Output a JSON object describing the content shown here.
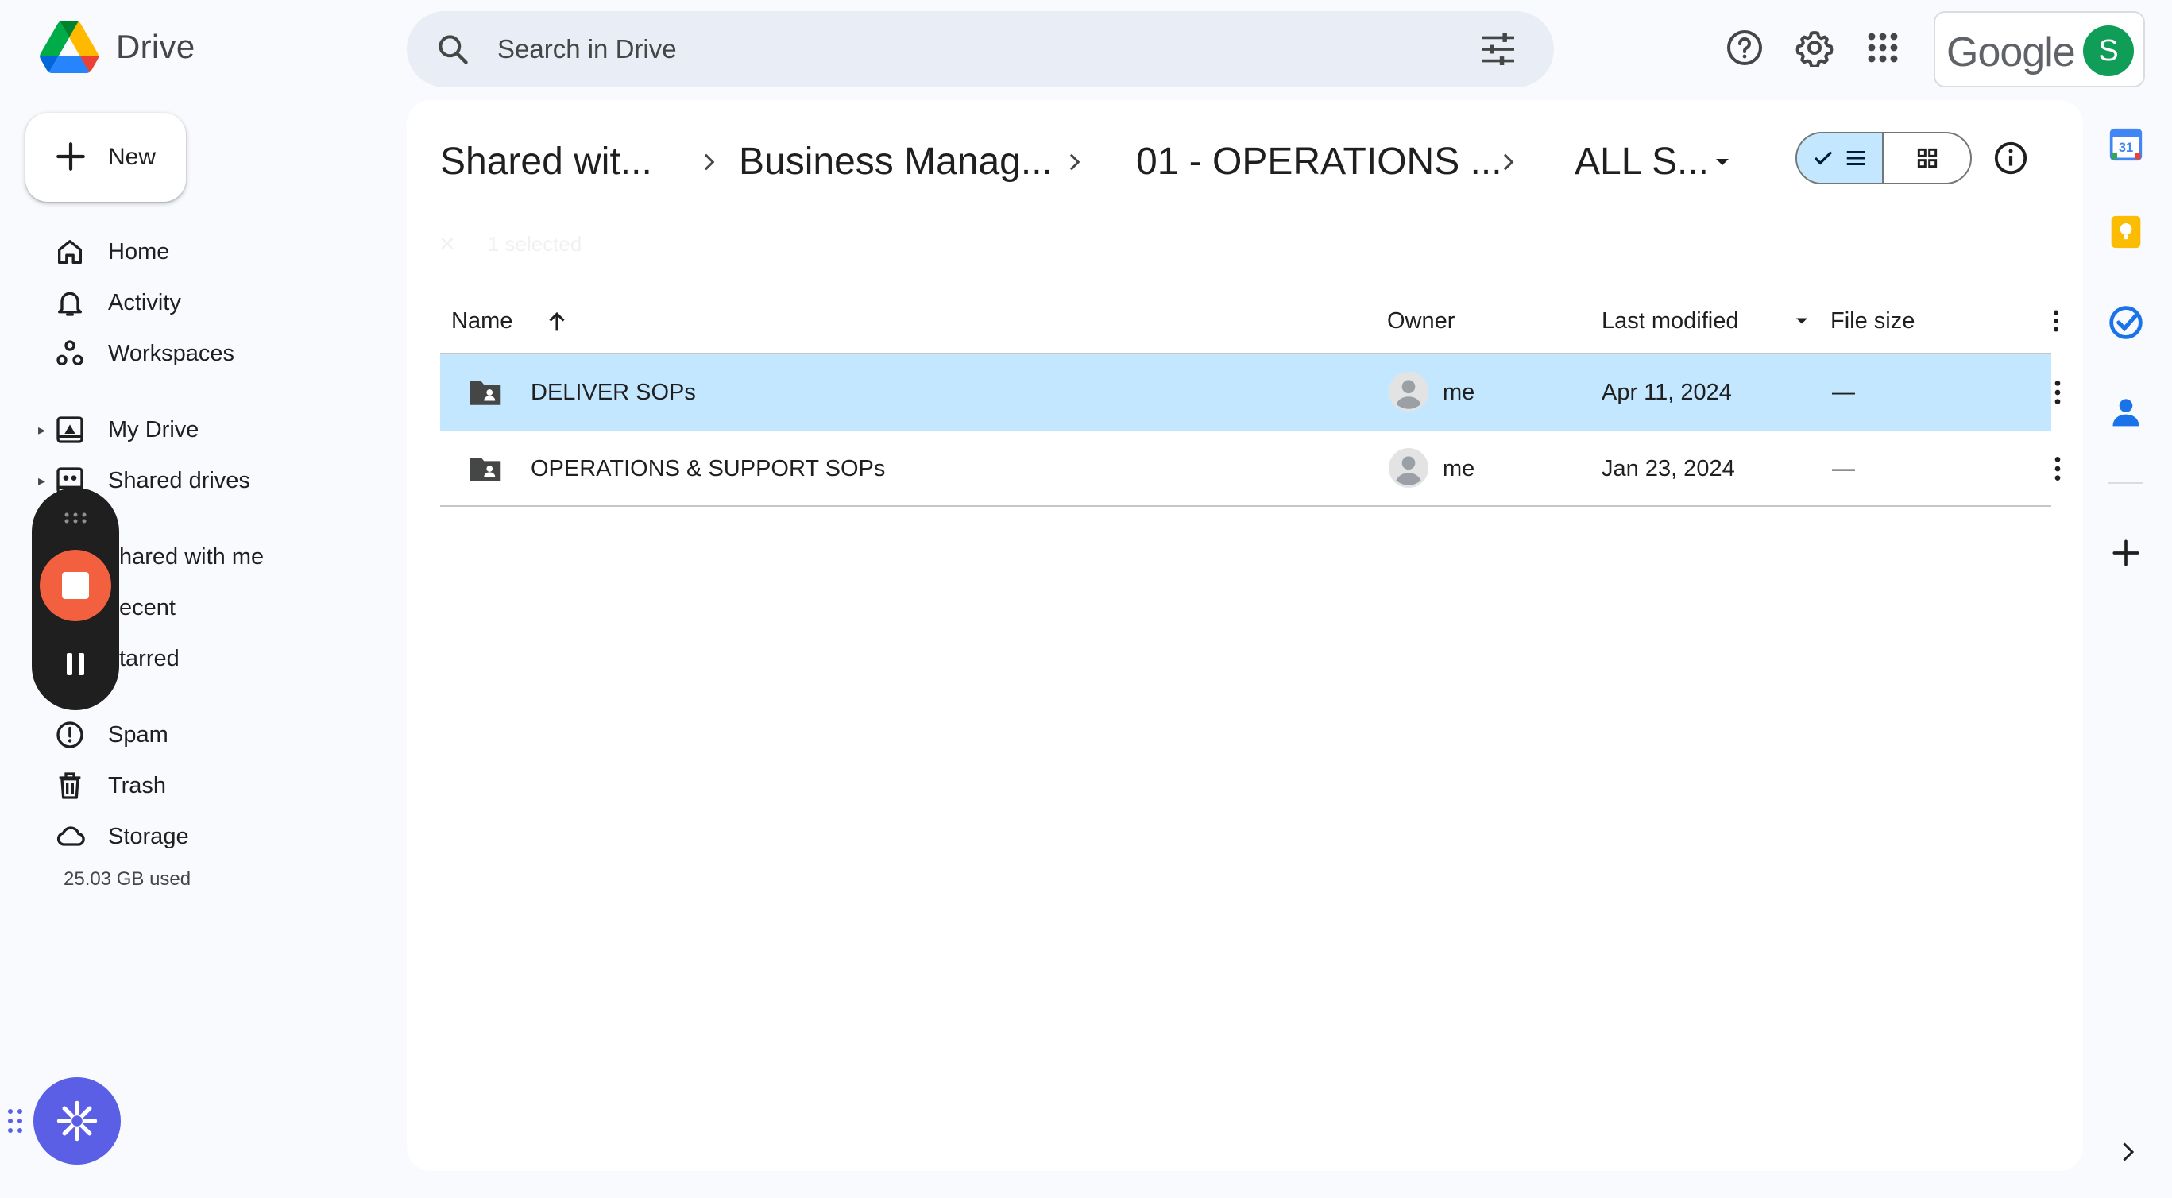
{
  "app": {
    "name": "Drive"
  },
  "search": {
    "placeholder": "Search in Drive"
  },
  "account": {
    "brand": "Google",
    "initial": "S"
  },
  "nav": {
    "new_label": "New",
    "items": [
      {
        "label": "Home",
        "icon": "home-icon"
      },
      {
        "label": "Activity",
        "icon": "bell-icon"
      },
      {
        "label": "Workspaces",
        "icon": "workspaces-icon"
      },
      {
        "label": "My Drive",
        "icon": "my-drive-icon"
      },
      {
        "label": "Shared drives",
        "icon": "shared-drives-icon"
      },
      {
        "label": "hared with me",
        "icon": "shared-with-me-icon"
      },
      {
        "label": "ecent",
        "icon": "recent-icon"
      },
      {
        "label": "tarred",
        "icon": "starred-icon"
      },
      {
        "label": "Spam",
        "icon": "spam-icon"
      },
      {
        "label": "Trash",
        "icon": "trash-icon"
      },
      {
        "label": "Storage",
        "icon": "cloud-icon"
      }
    ],
    "storage_used": "25.03 GB used"
  },
  "breadcrumbs": [
    "Shared wit...",
    "Business Manag...",
    "01 - OPERATIONS ...",
    "ALL S..."
  ],
  "selection_bar": {
    "text": "1 selected"
  },
  "table": {
    "columns": {
      "name": "Name",
      "owner": "Owner",
      "modified": "Last modified",
      "size": "File size"
    },
    "rows": [
      {
        "name": "DELIVER SOPs",
        "owner": "me",
        "modified": "Apr 11, 2024",
        "size": "—",
        "selected": true
      },
      {
        "name": "OPERATIONS & SUPPORT SOPs",
        "owner": "me",
        "modified": "Jan 23, 2024",
        "size": "—",
        "selected": false
      }
    ]
  },
  "colors": {
    "selected_row": "#c2e7ff",
    "record_button": "#f2603f",
    "assistant": "#5b5fe6",
    "avatar": "#0f9d58"
  }
}
